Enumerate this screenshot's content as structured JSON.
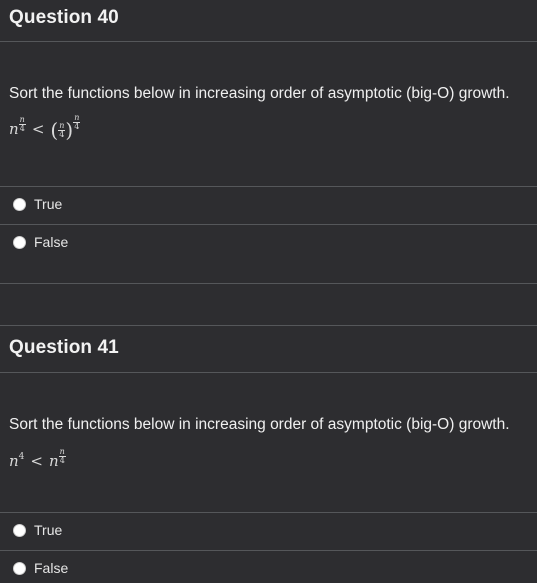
{
  "questions": [
    {
      "title": "Question 40",
      "prompt": "Sort the functions below in increasing order of asymptotic (big-O) growth.",
      "math": {
        "lhs_base": "n",
        "exp_num": "n",
        "exp_den": "4",
        "relation": "<",
        "rhs_num": "n",
        "rhs_den": "4"
      },
      "options": [
        "True",
        "False"
      ]
    },
    {
      "title": "Question 41",
      "prompt": "Sort  the functions below in increasing order of asymptotic (big-O) growth.",
      "math": {
        "lhs_base": "n",
        "lhs_exp": "4",
        "relation": "<",
        "rhs_base": "n",
        "exp_num": "n",
        "exp_den": "4"
      },
      "options": [
        "True",
        "False"
      ]
    }
  ]
}
